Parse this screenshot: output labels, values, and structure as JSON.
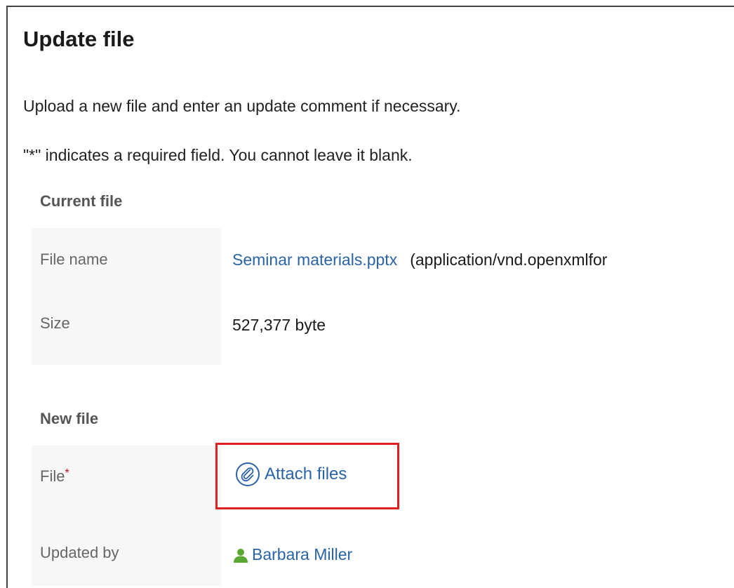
{
  "page": {
    "title": "Update file",
    "intro": "Upload a new file and enter an update comment if necessary.",
    "required_note": "\"*\" indicates a required field. You cannot leave it blank."
  },
  "current_file": {
    "heading": "Current file",
    "file_name_label": "File name",
    "file_name": "Seminar materials.pptx",
    "mime_type": "(application/vnd.openxmlfor",
    "size_label": "Size",
    "size_value": "527,377 byte"
  },
  "new_file": {
    "heading": "New file",
    "file_label": "File",
    "required_mark": "*",
    "attach_label": "Attach files",
    "attach_icon": "paperclip-icon",
    "updated_by_label": "Updated by",
    "updated_by_user": "Barbara Miller",
    "user_icon": "user-icon"
  },
  "colors": {
    "link": "#2a63a6",
    "highlight_box": "#e02020",
    "required_star": "#d0021b",
    "user_icon": "#5aa832"
  }
}
